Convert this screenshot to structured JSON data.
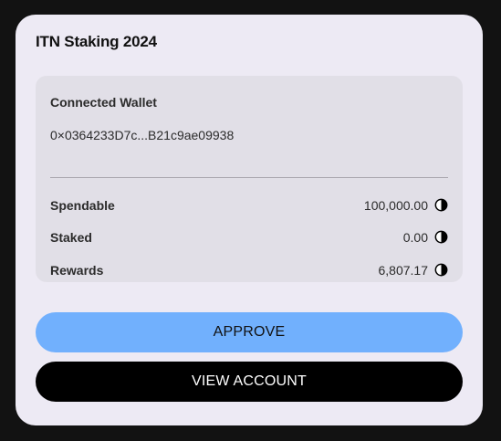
{
  "card": {
    "title": "ITN Staking 2024"
  },
  "wallet": {
    "label": "Connected Wallet",
    "address": "0×0364233D7c...B21c9ae09938"
  },
  "balances": [
    {
      "label": "Spendable",
      "value": "100,000.00",
      "icon": "token-icon"
    },
    {
      "label": "Staked",
      "value": "0.00",
      "icon": "token-icon"
    },
    {
      "label": "Rewards",
      "value": "6,807.17",
      "icon": "token-icon"
    }
  ],
  "actions": {
    "approve_label": "APPROVE",
    "view_account_label": "VIEW ACCOUNT"
  },
  "colors": {
    "background": "#121212",
    "card": "#edeaf4",
    "panel": "#e1dfe7",
    "approve": "#71b0fd",
    "view_account": "#000000"
  }
}
